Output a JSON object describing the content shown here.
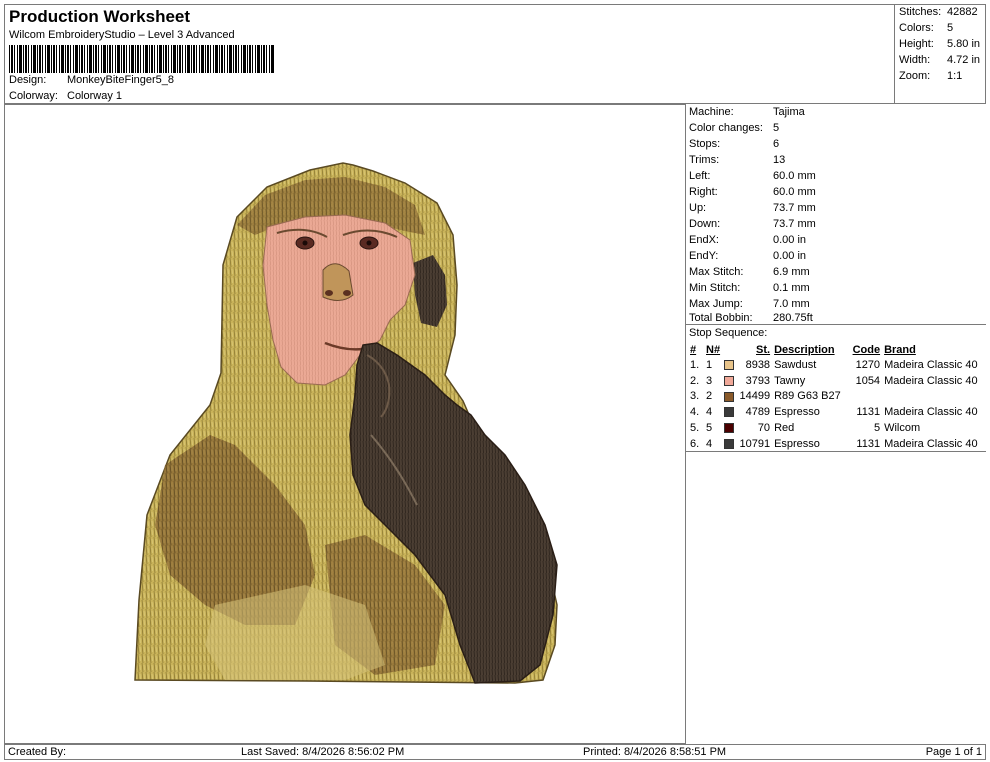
{
  "header": {
    "title": "Production Worksheet",
    "subtitle": "Wilcom EmbroideryStudio – Level 3 Advanced",
    "design_label": "Design:",
    "design_value": "MonkeyBiteFinger5_8",
    "colorway_label": "Colorway:",
    "colorway_value": "Colorway 1"
  },
  "stats": {
    "stitches_label": "Stitches:",
    "stitches_value": "42882",
    "colors_label": "Colors:",
    "colors_value": "5",
    "height_label": "Height:",
    "height_value": "5.80 in",
    "width_label": "Width:",
    "width_value": "4.72 in",
    "zoom_label": "Zoom:",
    "zoom_value": "1:1"
  },
  "machine": {
    "machine_label": "Machine:",
    "machine_value": "Tajima",
    "color_changes_label": "Color changes:",
    "color_changes_value": "5",
    "stops_label": "Stops:",
    "stops_value": "6",
    "trims_label": "Trims:",
    "trims_value": "13",
    "left_label": "Left:",
    "left_value": "60.0 mm",
    "right_label": "Right:",
    "right_value": "60.0 mm",
    "up_label": "Up:",
    "up_value": "73.7 mm",
    "down_label": "Down:",
    "down_value": "73.7 mm",
    "endx_label": "EndX:",
    "endx_value": "0.00 in",
    "endy_label": "EndY:",
    "endy_value": "0.00 in",
    "max_stitch_label": "Max Stitch:",
    "max_stitch_value": "6.9 mm",
    "min_stitch_label": "Min Stitch:",
    "min_stitch_value": "0.1 mm",
    "max_jump_label": "Max Jump:",
    "max_jump_value": "7.0 mm",
    "total_bobbin_label": "Total Bobbin:",
    "total_bobbin_value": "280.75ft"
  },
  "stop_sequence": {
    "title": "Stop Sequence:",
    "headers": {
      "idx": "#",
      "num": "N#",
      "st": "St.",
      "desc": "Description",
      "code": "Code",
      "brand": "Brand"
    },
    "rows": [
      {
        "idx": "1.",
        "num": "1",
        "color": "#e8c48a",
        "st": "8938",
        "desc": "Sawdust",
        "code": "1270",
        "brand": "Madeira Classic 40"
      },
      {
        "idx": "2.",
        "num": "3",
        "color": "#f0a898",
        "st": "3793",
        "desc": "Tawny",
        "code": "1054",
        "brand": "Madeira Classic 40"
      },
      {
        "idx": "3.",
        "num": "2",
        "color": "#8a5a2a",
        "st": "14499",
        "desc": "R89 G63 B27",
        "code": "",
        "brand": ""
      },
      {
        "idx": "4.",
        "num": "4",
        "color": "#3a3a3a",
        "st": "4789",
        "desc": "Espresso",
        "code": "1131",
        "brand": "Madeira Classic 40"
      },
      {
        "idx": "5.",
        "num": "5",
        "color": "#4a0000",
        "st": "70",
        "desc": "Red",
        "code": "5",
        "brand": "Wilcom"
      },
      {
        "idx": "6.",
        "num": "4",
        "color": "#3a3a3a",
        "st": "10791",
        "desc": "Espresso",
        "code": "1131",
        "brand": "Madeira Classic 40"
      }
    ]
  },
  "footer": {
    "created_by": "Created By:",
    "last_saved": "Last Saved: 8/4/2026 8:56:02 PM",
    "printed": "Printed: 8/4/2026 8:58:51 PM",
    "page": "Page 1 of 1"
  }
}
